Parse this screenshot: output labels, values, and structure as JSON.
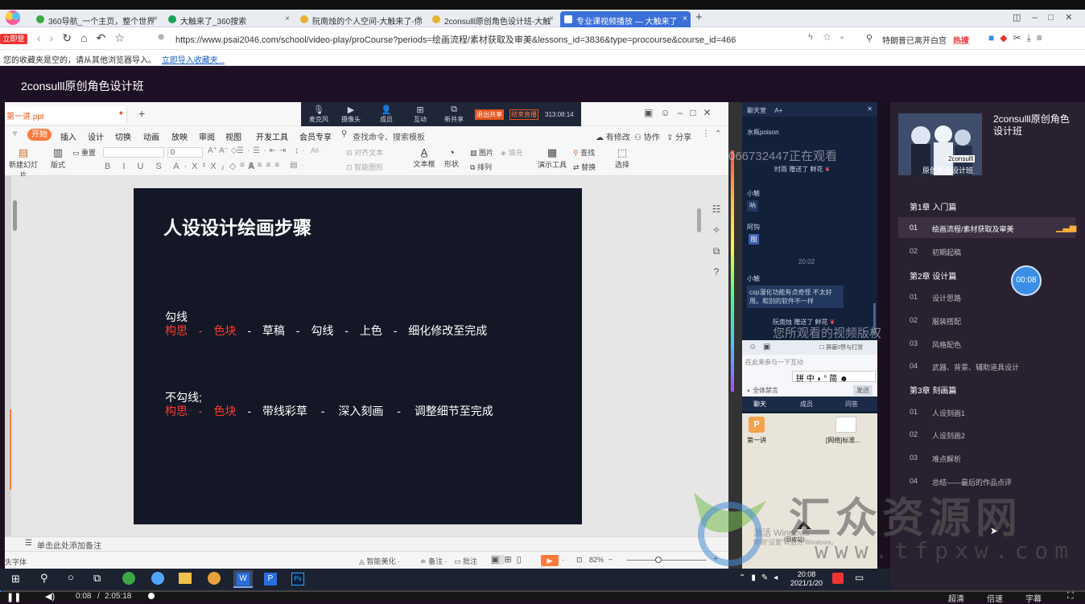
{
  "browser": {
    "tabs": [
      {
        "label": "360导航_一个主页，整个世界",
        "icon_color": "#3aa845",
        "active": false
      },
      {
        "label": "大触来了_360搜索",
        "icon_color": "#1aa35a",
        "active": false
      },
      {
        "label": "阮南烛的个人空间-大触来了-你",
        "icon_color": "#e7b130",
        "active": false
      },
      {
        "label": "2consulll原创角色设计班-大触",
        "icon_color": "#e7b130",
        "active": false
      },
      {
        "label": "专业课视频播放 — 大触来了",
        "icon_color": "#ffffff",
        "active": true
      }
    ],
    "new_tab": "+",
    "login_label": "立即登录",
    "url": "https://www.psai2046.com/school/video-play/proCourse?periods=绘画流程/素材获取及审美&lessons_id=3836&type=procourse&course_id=466",
    "search_hint": "特朗普已离开白宫",
    "hot_label": "热搜",
    "favbar_notice": "您的收藏夹是空的，请从其他浏览器导入。",
    "favbar_link": "立即导入收藏夹..."
  },
  "site": {
    "title": "2consulll原创角色设计班"
  },
  "meeting": {
    "buttons": [
      "麦克风",
      "摄像头",
      "成员",
      "互动",
      "新共享"
    ],
    "stop_share": "退出共享",
    "end_live": "结束直播",
    "timer": "313:08:14"
  },
  "wps": {
    "doc_tab": "第一讲.ppt",
    "tab_add": "+",
    "menu": [
      "开始",
      "插入",
      "设计",
      "切换",
      "动画",
      "放映",
      "审阅",
      "视图",
      "开发工具",
      "会员专享"
    ],
    "search": "查找命令、搜索模板",
    "right_menu": [
      "有修改",
      "协作",
      "分享"
    ],
    "ribbon_labels": {
      "new_slide": "新建幻灯片",
      "layout": "版式",
      "reset": "重置",
      "font_size": "0",
      "text_box": "文本框",
      "shape": "形状",
      "arrange": "排列",
      "picture": "图片",
      "fill": "填充",
      "show_tools": "演示工具",
      "find": "查找",
      "replace": "替换",
      "select": "选择",
      "align_text": "对齐文本",
      "smart_graphic": "智能图形"
    },
    "notes_placeholder": "单击此处添加备注",
    "status_left": "失字体",
    "status_items": [
      "智能美化",
      "备注",
      "批注"
    ],
    "zoom": "82%"
  },
  "slide": {
    "title": "人设设计绘画步骤",
    "section1_heading": "勾线",
    "section1_steps_red": [
      "构思",
      "色块"
    ],
    "section1_steps": [
      "草稿",
      "勾线",
      "上色",
      "细化修改至完成"
    ],
    "section2_heading": "不勾线;",
    "section2_steps_red": [
      "构思",
      "色块"
    ],
    "section2_steps": [
      "带线彩草",
      "深入刻画",
      "调整细节至完成"
    ],
    "separator": "-"
  },
  "chat": {
    "header": "聊天室",
    "font_toggle": "A+",
    "messages": [
      {
        "user": "水瓶poison",
        "text": "",
        "sub": "时雨 赠送了 鲜花"
      },
      {
        "user": "小触",
        "text": "呐"
      },
      {
        "user": "阿钩",
        "text": "图"
      },
      {
        "time": "20:02"
      },
      {
        "user": "小触",
        "text": "csp漫化功能有点奇怪 不太好用。和别的软件不一样"
      },
      {
        "user": "",
        "text": "",
        "sub": "阮南烛 赠送了 鲜花"
      }
    ],
    "watching_overlay": "066732447正在观看",
    "video_overlay": "您所观看的视频版权",
    "shield_label": "屏蔽0赞与打赏",
    "input_placeholder": "在此来参与一下互动",
    "ime_text": "中",
    "ime_simplified": "简",
    "mute_all": "全体禁言",
    "send": "发送",
    "bottom_tabs": [
      "聊天",
      "成员",
      "问答"
    ]
  },
  "desktop": {
    "icons": [
      "第一讲",
      "[网络]标准..."
    ],
    "activate_line1": "激活 Windows",
    "activate_line2": "转到\"设置\"以激活 Windows。",
    "recycle": "(回收站)"
  },
  "taskbar": {
    "time": "20:08",
    "date": "2021/1/20"
  },
  "course": {
    "title": "2consulll原创角色设计班",
    "thumb_text": "2consulll",
    "thumb_caption": "原创角色设计班",
    "timer_badge": "00:08",
    "chapters": [
      {
        "title": "第1章 入门篇",
        "lessons": [
          {
            "num": "01",
            "title": "绘画流程/素材获取及审美",
            "active": true
          },
          {
            "num": "02",
            "title": "初期起稿",
            "active": false
          }
        ]
      },
      {
        "title": "第2章 设计篇",
        "lessons": [
          {
            "num": "01",
            "title": "设计思路",
            "active": false
          },
          {
            "num": "02",
            "title": "服装搭配",
            "active": false
          },
          {
            "num": "03",
            "title": "风格配色",
            "active": false
          },
          {
            "num": "04",
            "title": "武器、背景、辅助道具设计",
            "active": false
          }
        ]
      },
      {
        "title": "第3章 刻画篇",
        "lessons": [
          {
            "num": "01",
            "title": "人设刻画1",
            "active": false
          },
          {
            "num": "02",
            "title": "人设刻画2",
            "active": false
          },
          {
            "num": "03",
            "title": "难点解析",
            "active": false
          },
          {
            "num": "04",
            "title": "总结——最后的作品点评",
            "active": false
          }
        ]
      }
    ]
  },
  "watermark": {
    "big": "汇众资源网",
    "url": "www.tfpxw.com"
  },
  "player": {
    "current": "0:08",
    "separator": "/",
    "duration": "2:05:18",
    "progress": 0.001,
    "right_labels": [
      "超清",
      "倍速",
      "字幕"
    ]
  }
}
